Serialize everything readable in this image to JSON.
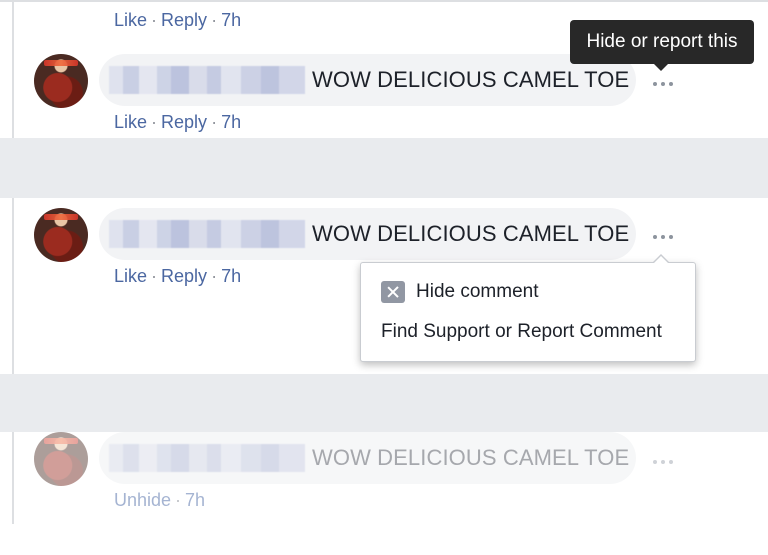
{
  "tooltip": {
    "text": "Hide or report this"
  },
  "comments": [
    {
      "text": "WOW DELICIOUS CAMEL TOE",
      "actions": {
        "like": "Like",
        "reply": "Reply",
        "separator": "·",
        "time": "7h"
      },
      "more_icon": "more-horizontal-icon"
    },
    {
      "text": "WOW DELICIOUS CAMEL TOE",
      "actions": {
        "like": "Like",
        "reply": "Reply",
        "separator": "·",
        "time": "7h"
      },
      "more_icon": "more-horizontal-icon"
    },
    {
      "text": "WOW DELICIOUS CAMEL TOE",
      "actions": {
        "unhide": "Unhide",
        "separator": "·",
        "time": "7h"
      },
      "more_icon": "more-horizontal-icon",
      "state": "hidden"
    }
  ],
  "context_menu": {
    "hide_label": "Hide comment",
    "hide_icon": "close-box-icon",
    "report_label": "Find Support or Report Comment"
  },
  "top_row": {
    "like": "Like",
    "reply": "Reply",
    "separator": "·",
    "time": "7h"
  },
  "colors": {
    "link": "#4b67a1",
    "separator_band": "#e9ebee",
    "bubble": "#f2f3f5",
    "tooltip_bg": "#282828"
  }
}
